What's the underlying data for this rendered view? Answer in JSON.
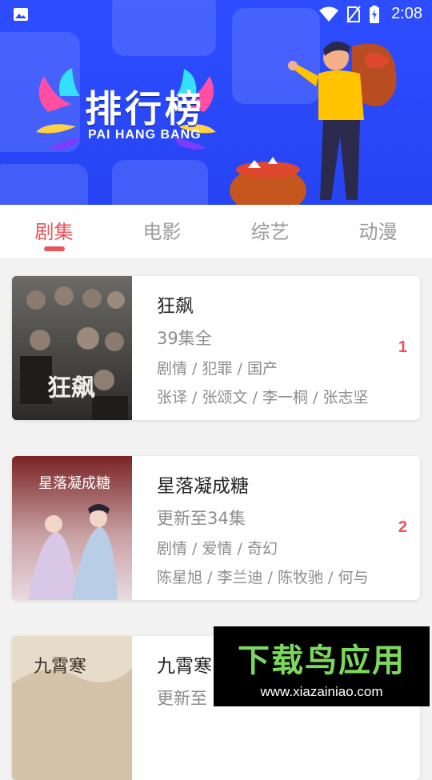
{
  "status_bar": {
    "time": "2:08",
    "icons": [
      "gallery-icon",
      "wifi-icon",
      "no-sim-icon",
      "battery-charging-icon"
    ]
  },
  "banner": {
    "title": "排行榜",
    "subtitle": "PAI HANG BANG"
  },
  "tabs": [
    {
      "label": "剧集",
      "active": true
    },
    {
      "label": "电影",
      "active": false
    },
    {
      "label": "综艺",
      "active": false
    },
    {
      "label": "动漫",
      "active": false
    }
  ],
  "items": [
    {
      "title": "狂飙",
      "status": "39集全",
      "genres": "剧情 / 犯罪 / 国产",
      "cast": "张译 / 张颂文 / 李一桐 / 张志坚",
      "rank": "1",
      "poster_text": "狂飙"
    },
    {
      "title": "星落凝成糖",
      "status": "更新至34集",
      "genres": "剧情 / 爱情 / 奇幻",
      "cast": "陈星旭 / 李兰迪 / 陈牧驰 / 何与",
      "rank": "2",
      "poster_text": "星落凝成糖"
    },
    {
      "title": "九霄寒",
      "status": "更新至",
      "genres": "",
      "cast": "",
      "rank": "",
      "poster_text": "九霄寒"
    }
  ],
  "watermark": {
    "brand": "下载鸟应用",
    "url": "www.xiazainiao.com"
  },
  "colors": {
    "accent": "#e8555a",
    "banner_blue": "#2644f3",
    "muted_text": "#8d8d8d",
    "watermark_green": "#7dd95e"
  }
}
